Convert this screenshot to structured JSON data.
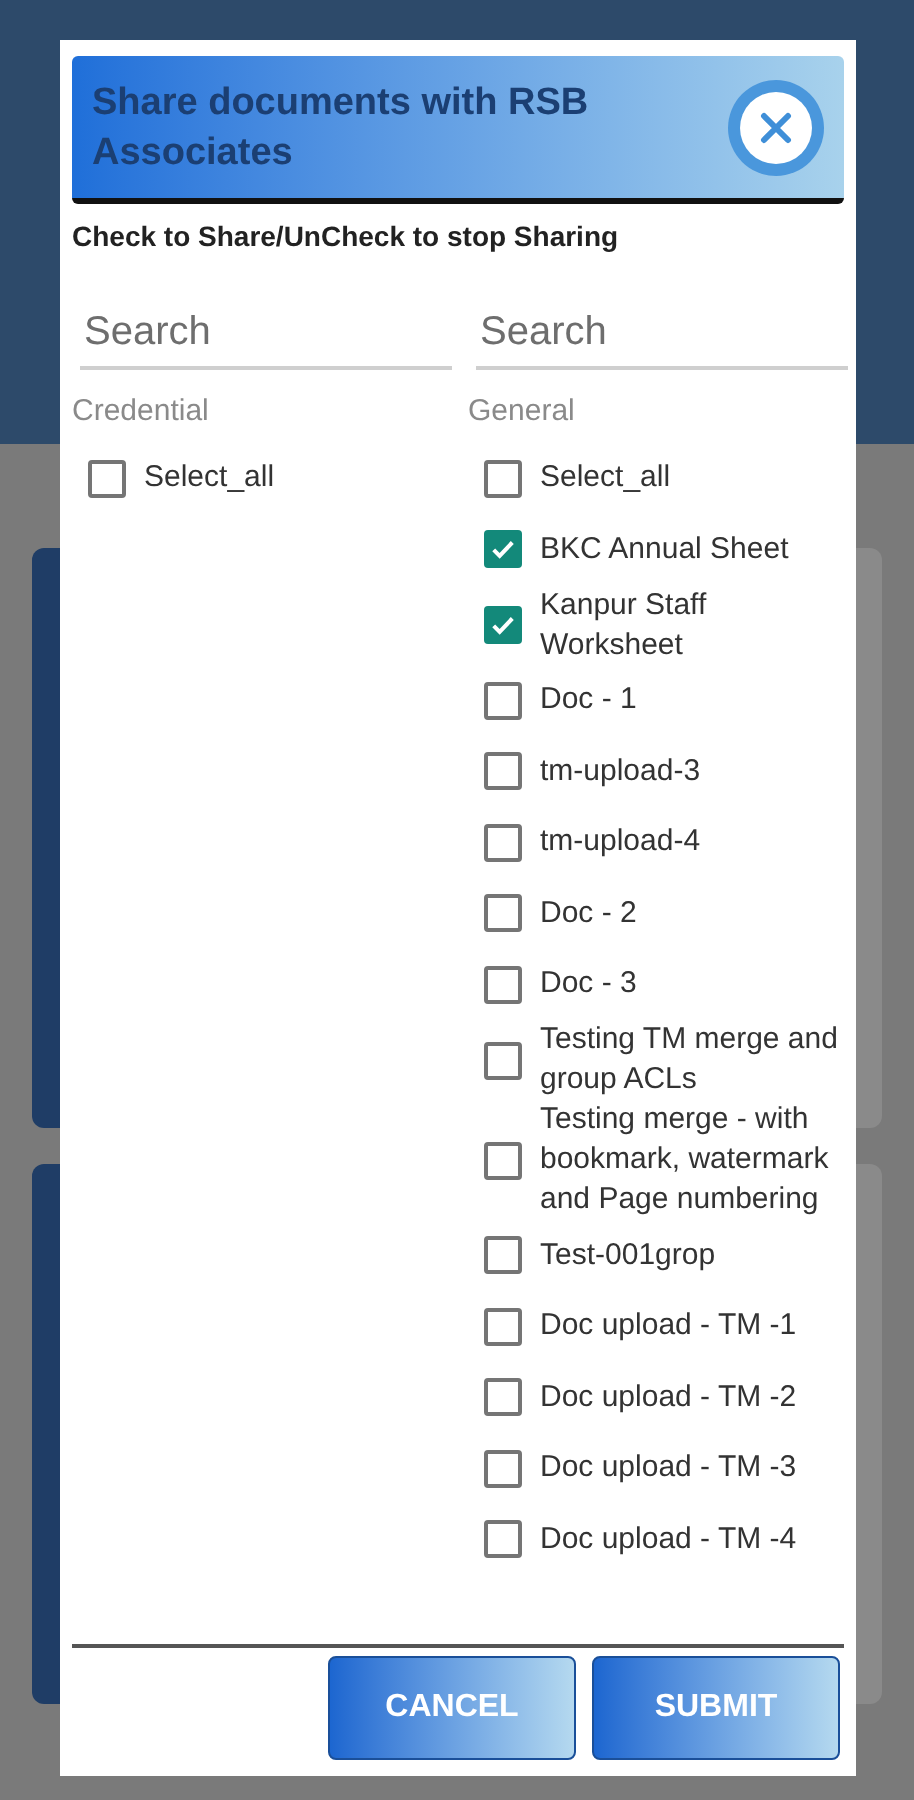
{
  "dialog": {
    "title": "Share documents with RSB Associates",
    "instruction": "Check to Share/UnCheck to stop Sharing",
    "columns": [
      {
        "search": {
          "placeholder": "Search"
        },
        "heading": "Credential",
        "items": [
          {
            "label": "Select_all",
            "checked": false
          }
        ]
      },
      {
        "search": {
          "placeholder": "Search"
        },
        "heading": "General",
        "items": [
          {
            "label": "Select_all",
            "checked": false
          },
          {
            "label": "BKC Annual Sheet",
            "checked": true
          },
          {
            "label": "Kanpur Staff Worksheet",
            "checked": true
          },
          {
            "label": "Doc - 1",
            "checked": false
          },
          {
            "label": "tm-upload-3",
            "checked": false
          },
          {
            "label": "tm-upload-4",
            "checked": false
          },
          {
            "label": "Doc - 2",
            "checked": false
          },
          {
            "label": "Doc - 3",
            "checked": false
          },
          {
            "label": "Testing TM merge and group ACLs",
            "checked": false
          },
          {
            "label": "Testing merge - with bookmark, watermark and Page numbering",
            "checked": false
          },
          {
            "label": "Test-001grop",
            "checked": false
          },
          {
            "label": "Doc upload - TM -1",
            "checked": false
          },
          {
            "label": "Doc upload - TM -2",
            "checked": false
          },
          {
            "label": "Doc upload - TM -3",
            "checked": false
          },
          {
            "label": "Doc upload - TM -4",
            "checked": false
          }
        ]
      }
    ],
    "buttons": [
      "CANCEL",
      "SUBMIT"
    ]
  }
}
